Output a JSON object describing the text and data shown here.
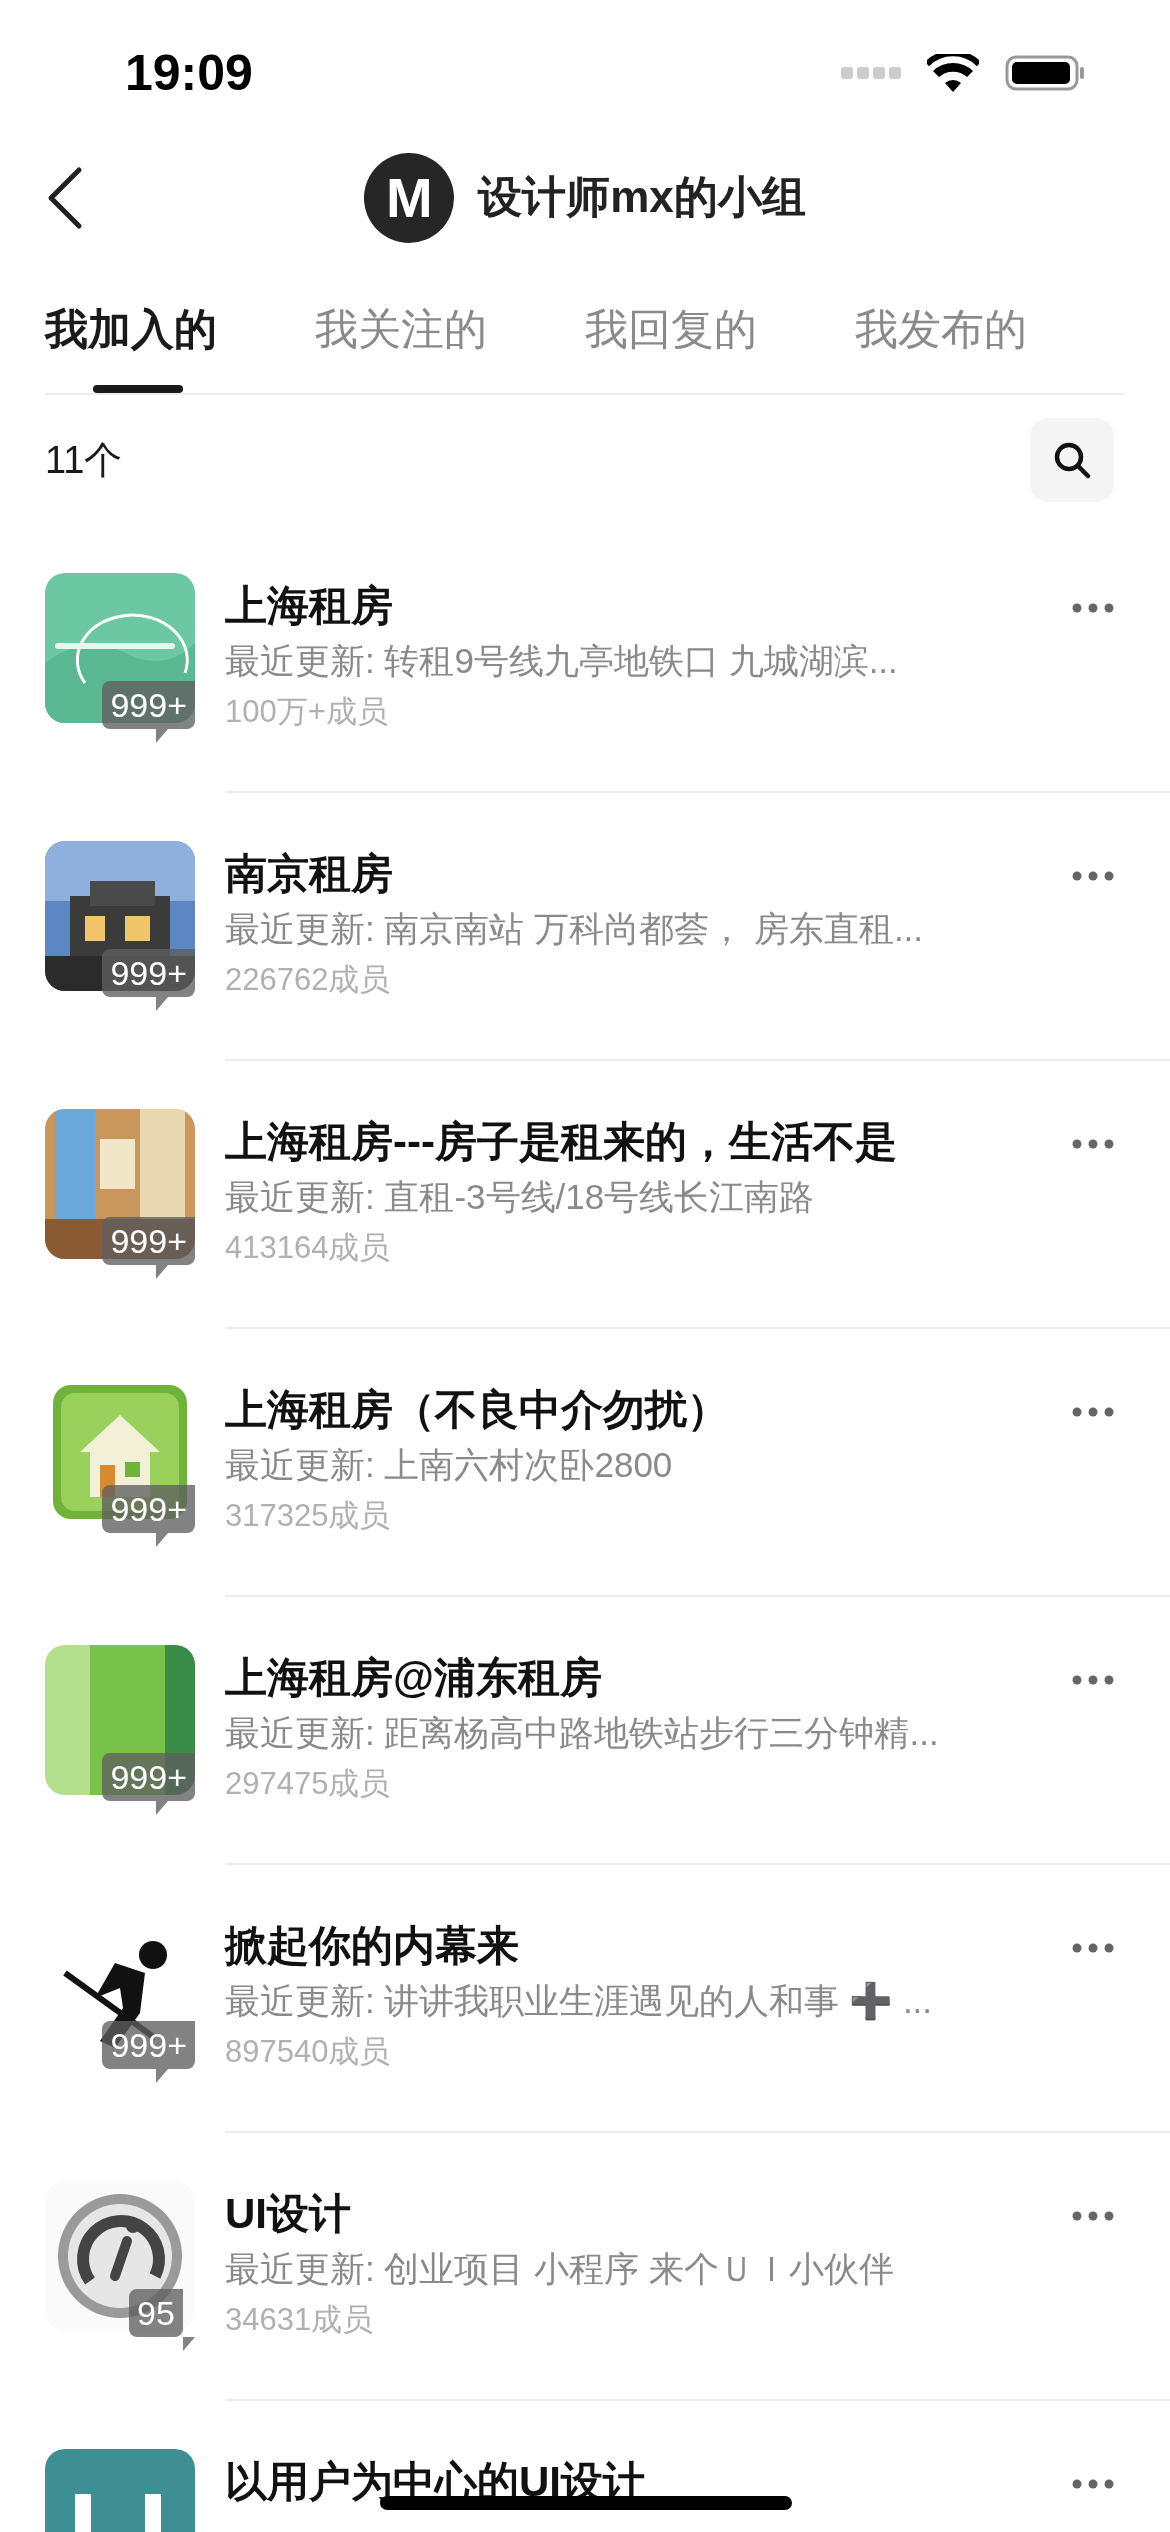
{
  "status_bar": {
    "time": "19:09"
  },
  "header": {
    "logo_text": "M",
    "title": "设计师mx的小组"
  },
  "tabs": [
    {
      "label": "我加入的",
      "selected": true
    },
    {
      "label": "我关注的",
      "selected": false
    },
    {
      "label": "我回复的",
      "selected": false
    },
    {
      "label": "我发布的",
      "selected": false
    }
  ],
  "count": "11个",
  "groups": [
    {
      "name": "上海租房",
      "latest": "最近更新: 转租9号线九亭地铁口  九城湖滨...",
      "members": "100万+成员",
      "badge": "999+"
    },
    {
      "name": "南京租房",
      "latest": "最近更新: 南京南站 万科尚都荟， 房东直租...",
      "members": "226762成员",
      "badge": "999+"
    },
    {
      "name": "上海租房---房子是租来的，生活不是",
      "latest": "最近更新: 直租-3号线/18号线长江南路",
      "members": "413164成员",
      "badge": "999+"
    },
    {
      "name": "上海租房（不良中介勿扰）",
      "latest": "最近更新: 上南六村次卧2800",
      "members": "317325成员",
      "badge": "999+"
    },
    {
      "name": "上海租房@浦东租房",
      "latest": "最近更新: 距离杨高中路地铁站步行三分钟精...",
      "members": "297475成员",
      "badge": "999+"
    },
    {
      "name": "掀起你的内幕来",
      "latest": "最近更新: 讲讲我职业生涯遇见的人和事 ➕ ...",
      "members": "897540成员",
      "badge": "999+"
    },
    {
      "name": "UI设计",
      "latest": "最近更新: 创业项目 小程序 来个ＵＩ小伙伴",
      "members": "34631成员",
      "badge": "95"
    },
    {
      "name": "以用户为中心的UI设计"
    }
  ]
}
